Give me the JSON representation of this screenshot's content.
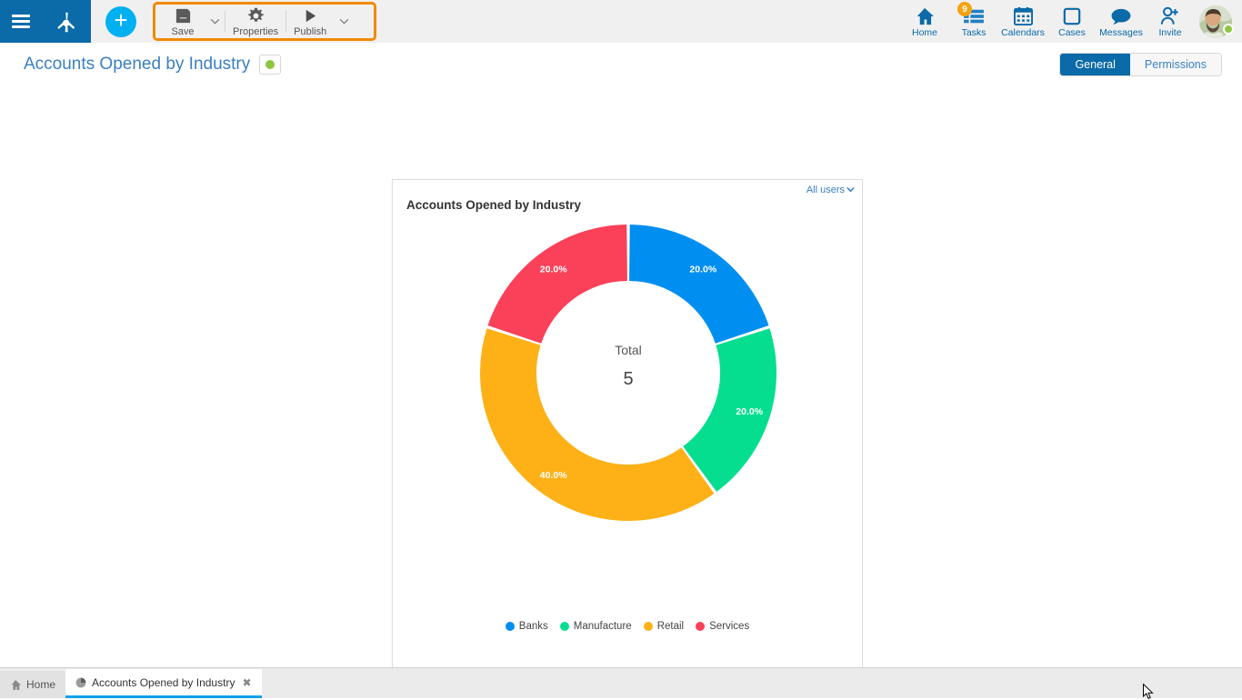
{
  "header": {
    "menu_icon": "hamburger-icon",
    "logo_icon": "app-logo-icon",
    "add_label": "+",
    "toolbar": [
      {
        "label": "Save",
        "icon": "save-icon",
        "has_caret": true
      },
      {
        "label": "Properties",
        "icon": "gear-icon",
        "has_caret": false
      },
      {
        "label": "Publish",
        "icon": "play-icon",
        "has_caret": true
      }
    ],
    "nav": [
      {
        "label": "Home",
        "icon": "home-icon",
        "badge": ""
      },
      {
        "label": "Tasks",
        "icon": "tasks-icon",
        "badge": "9"
      },
      {
        "label": "Calendars",
        "icon": "calendar-icon",
        "badge": ""
      },
      {
        "label": "Cases",
        "icon": "cases-icon",
        "badge": ""
      },
      {
        "label": "Messages",
        "icon": "message-icon",
        "badge": ""
      },
      {
        "label": "Invite",
        "icon": "invite-user-icon",
        "badge": ""
      }
    ],
    "avatar": {
      "name": "user-avatar",
      "status": "online"
    }
  },
  "title_row": {
    "title": "Accounts Opened by Industry",
    "status_dot_color": "#8dc63f",
    "tabs": [
      {
        "label": "General",
        "active": true
      },
      {
        "label": "Permissions",
        "active": false
      }
    ]
  },
  "card": {
    "title": "Accounts Opened by Industry",
    "users_filter": "All users",
    "caret_icon": "chevron-down-icon"
  },
  "chart_data": {
    "type": "pie",
    "variant": "donut",
    "title": "Accounts Opened by Industry",
    "categories": [
      "Banks",
      "Manufacture",
      "Retail",
      "Services"
    ],
    "values": [
      1,
      1,
      2,
      1
    ],
    "percentages": [
      "20.0%",
      "20.0%",
      "40.0%",
      "20.0%"
    ],
    "colors": [
      "#008ef0",
      "#05de8f",
      "#fdb117",
      "#fa4159"
    ],
    "center_label": "Total",
    "center_value": "5",
    "total": 5,
    "legend_position": "bottom",
    "start_angle_deg": 0,
    "donut_hole_ratio": 0.62
  },
  "colors": {
    "header_blue": "#0b6aa8",
    "accent_cyan": "#00b0f0",
    "highlight_orange": "#f08a00",
    "link_blue": "#3a7fc1",
    "badge_orange": "#f5a210",
    "status_green": "#8dc63f"
  },
  "taskbar": {
    "tabs": [
      {
        "label": "Home",
        "icon": "home-small-icon",
        "active": false,
        "closable": false
      },
      {
        "label": "Accounts Opened by Industry",
        "icon": "chart-small-icon",
        "active": true,
        "closable": true,
        "close_icon": "close-icon"
      }
    ]
  }
}
